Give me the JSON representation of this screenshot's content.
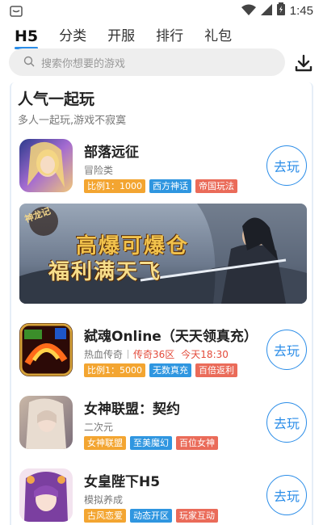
{
  "status_bar": {
    "time": "1:45"
  },
  "tabs": [
    {
      "label": "H5",
      "active": true
    },
    {
      "label": "分类",
      "active": false
    },
    {
      "label": "开服",
      "active": false
    },
    {
      "label": "排行",
      "active": false
    },
    {
      "label": "礼包",
      "active": false
    }
  ],
  "search": {
    "placeholder": "搜索你想要的游戏"
  },
  "section": {
    "title": "人气一起玩",
    "subtitle": "多人一起玩,游戏不寂寞"
  },
  "go_label": "去玩",
  "games": [
    {
      "name": "部落远征",
      "category": "冒险类",
      "tags": [
        {
          "text": "比例1：1000",
          "color": "#f3a531"
        },
        {
          "text": "西方神话",
          "color": "#2f96e0"
        },
        {
          "text": "帝国玩法",
          "color": "#ea6b59"
        }
      ]
    },
    {
      "name": "弑魂Online（天天领真充）",
      "category": "热血传奇",
      "server": "传奇36区",
      "server_time": "今天18:30",
      "tags": [
        {
          "text": "比例1：5000",
          "color": "#f3a531"
        },
        {
          "text": "无数真充",
          "color": "#2f96e0"
        },
        {
          "text": "百倍返利",
          "color": "#ea6b59"
        }
      ]
    },
    {
      "name": "女神联盟：契约",
      "category": "二次元",
      "tags": [
        {
          "text": "女神联盟",
          "color": "#f3a531"
        },
        {
          "text": "至美魔幻",
          "color": "#2f96e0"
        },
        {
          "text": "百位女神",
          "color": "#ea6b59"
        }
      ]
    },
    {
      "name": "女皇陛下H5",
      "category": "模拟养成",
      "tags": [
        {
          "text": "古风恋爱",
          "color": "#f3a531"
        },
        {
          "text": "动态开区",
          "color": "#2f96e0"
        },
        {
          "text": "玩家互动",
          "color": "#ea6b59"
        }
      ]
    }
  ],
  "banner": {
    "logo_text": "神龙记",
    "slogan_line1": "高爆可爆仓",
    "slogan_line2": "福利满天飞"
  },
  "colors": {
    "accent": "#2b8de8",
    "tag_orange": "#f3a531",
    "tag_blue": "#2f96e0",
    "tag_red": "#ea6b59",
    "hot_red": "#e34b3b"
  }
}
